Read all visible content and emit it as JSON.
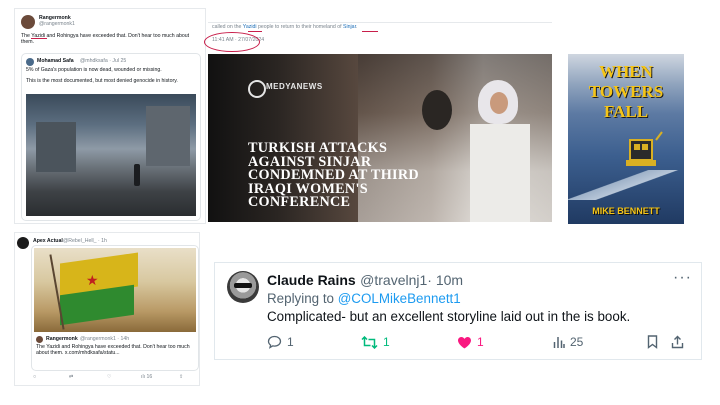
{
  "tweet1": {
    "author": "Rangermonk",
    "handle": "@rangermonk1",
    "text": "The Yazidi and Rohingya have exceeded that. Don't hear too much about them.",
    "quote": {
      "author": "Mohamad Safa",
      "handle": "@mhdksafa · Jul 25",
      "line1": "5% of Gaza's population is now dead, wounded or missing.",
      "line2": "This is the most documented, but most denied genocide in history."
    }
  },
  "snippet": {
    "text_pre": "called on the ",
    "yazidi": "Yazidi",
    "text_mid": " people to return to their homeland of ",
    "sinjar": "Sinjar",
    "text_post": ".",
    "timestamp": "11:41 AM · 27/07/2024"
  },
  "news": {
    "logo": "MEDYANEWS",
    "headline": [
      "TURKISH ATTACKS",
      "AGAINST SINJAR",
      "CONDEMNED AT THIRD",
      "IRAQI WOMEN'S",
      "CONFERENCE"
    ]
  },
  "book": {
    "title": [
      "WHEN",
      "TOWERS",
      "FALL"
    ],
    "author": "MIKE BENNETT"
  },
  "tweet2": {
    "author": "Apex Actual",
    "handle": "@Rebel_Hell_ · 1h",
    "quote": {
      "author": "Rangermonk",
      "handle": "@rangermonk1 · 14h",
      "text": "The Yazidi and Rohingya have exceeded that. Don't hear too much about them. x.com/mhdksafa/statu..."
    },
    "actions": {
      "views": "16"
    }
  },
  "tweet3": {
    "name": "Claude Rains",
    "handle": "@travelnj1",
    "time": "· 10m",
    "replying_label": "Replying to ",
    "replying_handle": "@COLMikeBennett1",
    "text": "Complicated- but an excellent storyline laid out in the is book.",
    "replies": "1",
    "retweets": "1",
    "likes": "1",
    "views": "25",
    "colors": {
      "retweet": "#00ba7c",
      "like": "#f91880",
      "link": "#1d9bf0"
    }
  }
}
